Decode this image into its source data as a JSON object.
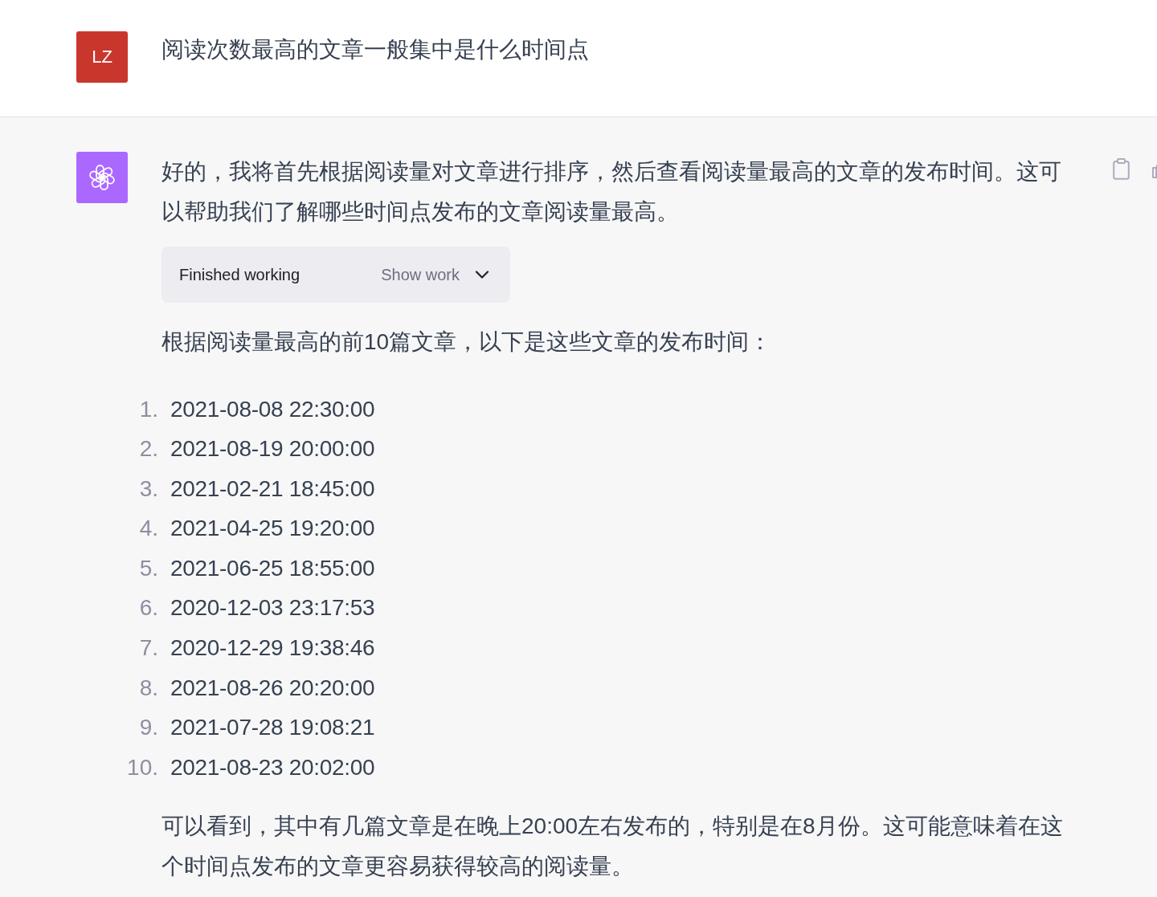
{
  "user_message": {
    "avatar_initials": "LZ",
    "text": "阅读次数最高的文章一般集中是什么时间点"
  },
  "assistant_message": {
    "blocks": [
      {
        "kind": "paragraph",
        "text": "好的，我将首先根据阅读量对文章进行排序，然后查看阅读量最高的文章的发布时间。这可以帮助我们了解哪些时间点发布的文章阅读量最高。"
      },
      {
        "kind": "tool_status",
        "status": "Finished working",
        "toggle": "Show work",
        "expanded": false
      },
      {
        "kind": "paragraph",
        "text": "根据阅读量最高的前10篇文章，以下是这些文章的发布时间："
      },
      {
        "kind": "ordered_list",
        "items": [
          {
            "number": "1.",
            "text": "2021-08-08 22:30:00"
          },
          {
            "number": "2.",
            "text": "2021-08-19 20:00:00"
          },
          {
            "number": "3.",
            "text": "2021-02-21 18:45:00"
          },
          {
            "number": "4.",
            "text": "2021-04-25 19:20:00"
          },
          {
            "number": "5.",
            "text": "2021-06-25 18:55:00"
          },
          {
            "number": "6.",
            "text": "2020-12-03 23:17:53"
          },
          {
            "number": "7.",
            "text": "2020-12-29 19:38:46"
          },
          {
            "number": "8.",
            "text": "2021-08-26 20:20:00"
          },
          {
            "number": "9.",
            "text": "2021-07-28 19:08:21"
          },
          {
            "number": "10.",
            "text": "2021-08-23 20:02:00"
          }
        ]
      },
      {
        "kind": "paragraph",
        "text": "可以看到，其中有几篇文章是在晚上20:00左右发布的，特别是在8月份。这可能意味着在这个时间点发布的文章更容易获得较高的阅读量。"
      }
    ]
  }
}
